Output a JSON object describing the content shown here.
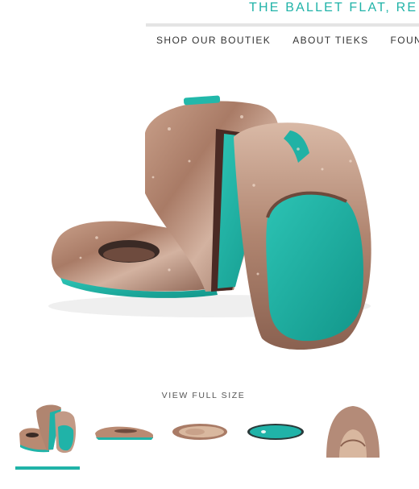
{
  "header": {
    "tagline": "THE BALLET FLAT, RE"
  },
  "nav": {
    "items": [
      {
        "label": "SHOP OUR BOUTIEK"
      },
      {
        "label": "ABOUT TIEKS"
      },
      {
        "label": "FOUN"
      }
    ]
  },
  "product": {
    "view_full_size": "VIEW FULL SIZE",
    "thumbnails": [
      {
        "name": "folded-pair",
        "selected": true
      },
      {
        "name": "side-view",
        "selected": false
      },
      {
        "name": "top-view",
        "selected": false
      },
      {
        "name": "sole-view",
        "selected": false
      },
      {
        "name": "closeup-view",
        "selected": false
      }
    ]
  },
  "colors": {
    "accent": "#20b3a8",
    "sole_teal": "#1fb0a3",
    "metallic_rose": "#b98a72",
    "divider": "#e4e4e4"
  }
}
